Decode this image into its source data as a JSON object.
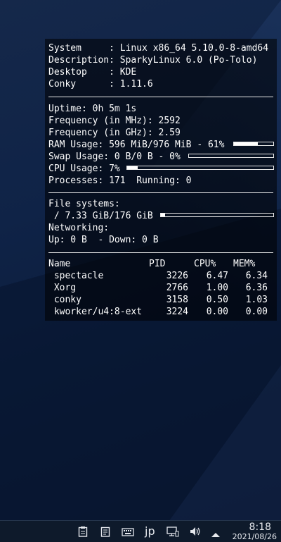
{
  "conky": {
    "system": [
      {
        "label": "System     : ",
        "value": "Linux x86_64 5.10.0-8-amd64"
      },
      {
        "label": "Description: ",
        "value": "SparkyLinux 6.0 (Po-Tolo)"
      },
      {
        "label": "Desktop    : ",
        "value": "KDE"
      },
      {
        "label": "Conky      : ",
        "value": "1.11.6"
      }
    ],
    "uptime": "Uptime: 0h 5m 1s",
    "freq_mhz": "Frequency (in MHz): 2592",
    "freq_ghz": "Frequency (in GHz): 2.59",
    "ram": {
      "text": "RAM Usage: 596 MiB/976 MiB - 61%",
      "percent": 61
    },
    "swap": {
      "text": "Swap Usage: 0 B/0 B - 0%",
      "percent": 0
    },
    "cpu": {
      "text": "CPU Usage: 7%",
      "percent": 7
    },
    "processes": "Processes: 171  Running: 0",
    "fs_header": "File systems:",
    "fs_root": {
      "text": " / 7.33 GiB/176 GiB",
      "percent": 4
    },
    "net_header": "Networking:",
    "net": "Up: 0 B  - Down: 0 B",
    "proc_headers": {
      "name": "Name",
      "pid": "PID",
      "cpu": "CPU%",
      "mem": "MEM%"
    },
    "procs": [
      {
        "name": " spectacle",
        "pid": "3226",
        "cpu": "6.47",
        "mem": "6.34"
      },
      {
        "name": " Xorg",
        "pid": "2766",
        "cpu": "1.00",
        "mem": "6.36"
      },
      {
        "name": " conky",
        "pid": "3158",
        "cpu": "0.50",
        "mem": "1.03"
      },
      {
        "name": " kworker/u4:8-ext",
        "pid": "3224",
        "cpu": "0.00",
        "mem": "0.00"
      }
    ]
  },
  "taskbar": {
    "input_method": "jp",
    "time": "8:18",
    "date": "2021/08/26",
    "icons": [
      "clipboard-icon",
      "notes-icon",
      "keyboard-icon",
      "input-method-icon",
      "network-icon",
      "volume-icon",
      "expand-tray-icon"
    ]
  }
}
